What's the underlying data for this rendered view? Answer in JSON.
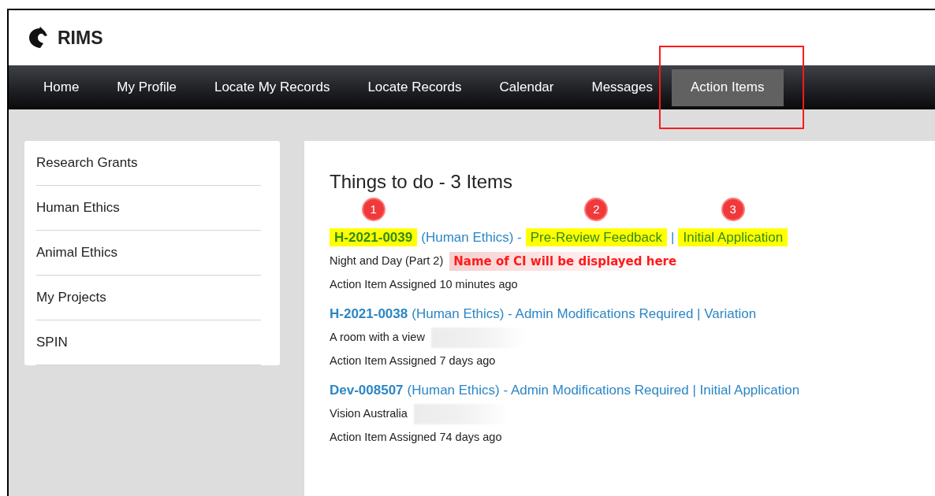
{
  "brand": {
    "name": "RIMS"
  },
  "nav": [
    {
      "label": "Home",
      "selected": false
    },
    {
      "label": "My Profile",
      "selected": false
    },
    {
      "label": "Locate My Records",
      "selected": false
    },
    {
      "label": "Locate Records",
      "selected": false
    },
    {
      "label": "Calendar",
      "selected": false
    },
    {
      "label": "Messages",
      "selected": false
    },
    {
      "label": "Action Items",
      "selected": true,
      "framed": true
    }
  ],
  "sidebar": {
    "items": [
      {
        "label": "Research Grants"
      },
      {
        "label": "Human Ethics"
      },
      {
        "label": "Animal Ethics"
      },
      {
        "label": "My Projects"
      },
      {
        "label": "SPIN"
      }
    ]
  },
  "main": {
    "title": "Things to do - 3 Items",
    "items": [
      {
        "segments": [
          {
            "text": "H-2021-0039",
            "kind": "id",
            "highlighted": true,
            "marker": "1"
          },
          {
            "text": "(Human Ethics) -",
            "kind": "text",
            "highlighted": false
          },
          {
            "text": "Pre-Review Feedback",
            "kind": "text",
            "highlighted": true,
            "marker": "2"
          },
          {
            "text": "|",
            "kind": "text",
            "highlighted": false
          },
          {
            "text": "Initial Application",
            "kind": "text",
            "highlighted": true,
            "marker": "3"
          }
        ],
        "project": "Night and Day (Part 2)",
        "note": "Name of CI will be displayed here",
        "redacted": false,
        "assigned": "Action Item Assigned 10 minutes ago"
      },
      {
        "segments": [
          {
            "text": "H-2021-0038",
            "kind": "id",
            "highlighted": false
          },
          {
            "text": "(Human Ethics) - Admin Modifications Required | Variation",
            "kind": "text",
            "highlighted": false
          }
        ],
        "project": "A room with a view",
        "redacted": true,
        "assigned": "Action Item Assigned 7 days ago"
      },
      {
        "segments": [
          {
            "text": "Dev-008507",
            "kind": "id",
            "highlighted": false
          },
          {
            "text": "(Human Ethics) - Admin Modifications Required | Initial Application",
            "kind": "text",
            "highlighted": false
          }
        ],
        "project": "Vision Australia",
        "redacted": true,
        "assigned": "Action Item Assigned 74 days ago"
      }
    ]
  }
}
